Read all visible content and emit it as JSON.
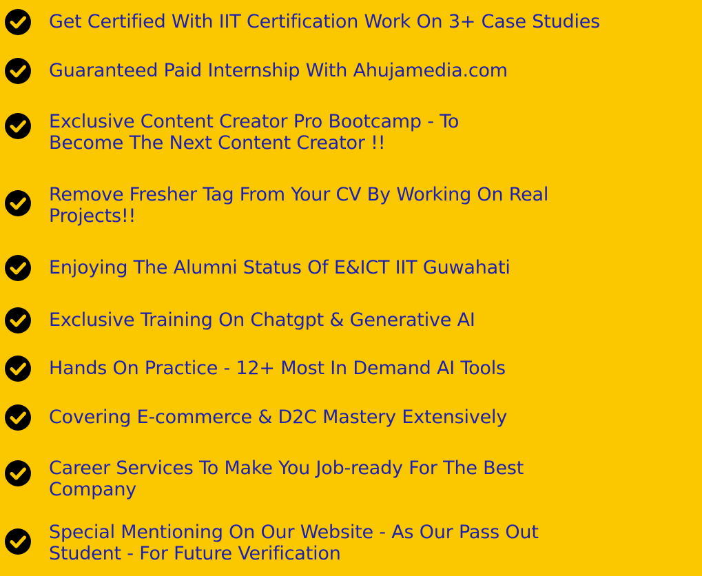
{
  "colors": {
    "background": "#fbc800",
    "text": "#1c1fb0",
    "icon": "#000000"
  },
  "benefits": {
    "icon": "check-circle-icon",
    "items": [
      "Get Certified With IIT Certification Work On 3+ Case Studies",
      "Guaranteed Paid Internship With Ahujamedia.com",
      "Exclusive Content Creator Pro Bootcamp - To\nBecome The Next Content Creator !!",
      "Remove Fresher Tag From Your CV By Working On Real\nProjects!!",
      "Enjoying The Alumni Status Of E&ICT IIT Guwahati",
      "Exclusive Training On Chatgpt & Generative AI",
      "Hands On Practice - 12+ Most In Demand AI Tools",
      "Covering E-commerce & D2C Mastery Extensively",
      "Career Services To Make You Job-ready For The Best\nCompany",
      "Special Mentioning On Our Website - As Our Pass Out\nStudent - For Future Verification"
    ]
  }
}
